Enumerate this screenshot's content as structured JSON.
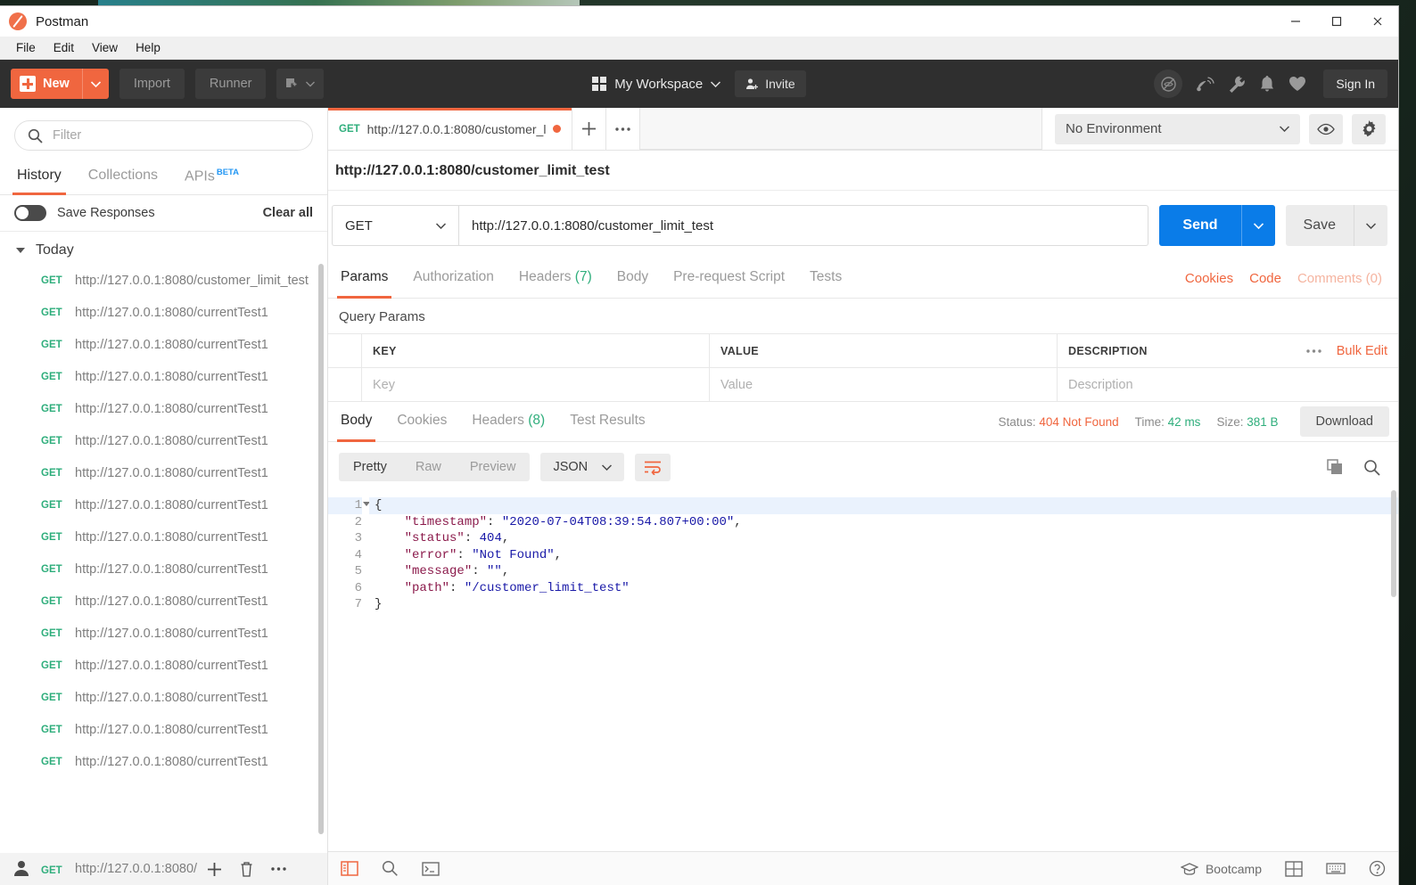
{
  "window": {
    "title": "Postman",
    "controls": {
      "minimize": "minimize-icon",
      "maximize": "maximize-icon",
      "close": "close-icon"
    }
  },
  "menubar": {
    "items": [
      "File",
      "Edit",
      "View",
      "Help"
    ]
  },
  "header": {
    "new_button": "New",
    "import_button": "Import",
    "runner_button": "Runner",
    "workspace": "My Workspace",
    "invite": "Invite",
    "sign_in": "Sign In",
    "icons": [
      "eye-off-icon",
      "satellite-dish-icon",
      "wrench-icon",
      "bell-icon",
      "heart-icon"
    ]
  },
  "sidebar": {
    "filter_placeholder": "Filter",
    "tabs": [
      {
        "label": "History",
        "active": true
      },
      {
        "label": "Collections",
        "active": false
      },
      {
        "label": "APIs",
        "badge": "BETA",
        "active": false
      }
    ],
    "save_responses_label": "Save Responses",
    "save_responses_on": false,
    "clear_all": "Clear all",
    "group_label": "Today",
    "items": [
      {
        "method": "GET",
        "url": "http://127.0.0.1:8080/customer_limit_test"
      },
      {
        "method": "GET",
        "url": "http://127.0.0.1:8080/currentTest1"
      },
      {
        "method": "GET",
        "url": "http://127.0.0.1:8080/currentTest1"
      },
      {
        "method": "GET",
        "url": "http://127.0.0.1:8080/currentTest1"
      },
      {
        "method": "GET",
        "url": "http://127.0.0.1:8080/currentTest1"
      },
      {
        "method": "GET",
        "url": "http://127.0.0.1:8080/currentTest1"
      },
      {
        "method": "GET",
        "url": "http://127.0.0.1:8080/currentTest1"
      },
      {
        "method": "GET",
        "url": "http://127.0.0.1:8080/currentTest1"
      },
      {
        "method": "GET",
        "url": "http://127.0.0.1:8080/currentTest1"
      },
      {
        "method": "GET",
        "url": "http://127.0.0.1:8080/currentTest1"
      },
      {
        "method": "GET",
        "url": "http://127.0.0.1:8080/currentTest1"
      },
      {
        "method": "GET",
        "url": "http://127.0.0.1:8080/currentTest1"
      },
      {
        "method": "GET",
        "url": "http://127.0.0.1:8080/currentTest1"
      },
      {
        "method": "GET",
        "url": "http://127.0.0.1:8080/currentTest1"
      },
      {
        "method": "GET",
        "url": "http://127.0.0.1:8080/currentTest1"
      },
      {
        "method": "GET",
        "url": "http://127.0.0.1:8080/currentTest1"
      }
    ],
    "last_item": {
      "method": "GET",
      "url": "http://127.0.0.1:8080/"
    }
  },
  "request_tab": {
    "method": "GET",
    "label": "http://127.0.0.1:8080/customer_l",
    "unsaved": true
  },
  "environment": {
    "selected": "No Environment"
  },
  "request": {
    "title": "http://127.0.0.1:8080/customer_limit_test",
    "method": "GET",
    "url": "http://127.0.0.1:8080/customer_limit_test",
    "send_label": "Send",
    "save_label": "Save",
    "tabs": [
      {
        "label": "Params",
        "active": true
      },
      {
        "label": "Authorization",
        "active": false
      },
      {
        "label": "Headers",
        "count": "(7)",
        "active": false
      },
      {
        "label": "Body",
        "active": false
      },
      {
        "label": "Pre-request Script",
        "active": false
      },
      {
        "label": "Tests",
        "active": false
      }
    ],
    "links": {
      "cookies": "Cookies",
      "code": "Code",
      "comments": "Comments (0)"
    },
    "query_params_title": "Query Params",
    "table": {
      "headers": [
        "KEY",
        "VALUE",
        "DESCRIPTION"
      ],
      "bulk_edit": "Bulk Edit",
      "placeholder_row": [
        "Key",
        "Value",
        "Description"
      ]
    }
  },
  "response": {
    "tabs": [
      {
        "label": "Body",
        "active": true
      },
      {
        "label": "Cookies",
        "active": false
      },
      {
        "label": "Headers",
        "count": "(8)",
        "active": false
      },
      {
        "label": "Test Results",
        "active": false
      }
    ],
    "status_label": "Status:",
    "status_value": "404 Not Found",
    "time_label": "Time:",
    "time_value": "42 ms",
    "size_label": "Size:",
    "size_value": "381 B",
    "download": "Download",
    "view_modes": [
      {
        "label": "Pretty",
        "active": true
      },
      {
        "label": "Raw",
        "active": false
      },
      {
        "label": "Preview",
        "active": false
      }
    ],
    "format": "JSON",
    "wrap_icon": "wrap-lines-icon",
    "copy_icon": "copy-icon",
    "search_icon": "search-icon",
    "body_lines": [
      {
        "n": "1",
        "tokens": [
          {
            "t": "p",
            "v": "{"
          }
        ]
      },
      {
        "n": "2",
        "tokens": [
          {
            "t": "k",
            "v": "    \"timestamp\""
          },
          {
            "t": "p",
            "v": ": "
          },
          {
            "t": "s",
            "v": "\"2020-07-04T08:39:54.807+00:00\""
          },
          {
            "t": "p",
            "v": ","
          }
        ]
      },
      {
        "n": "3",
        "tokens": [
          {
            "t": "k",
            "v": "    \"status\""
          },
          {
            "t": "p",
            "v": ": "
          },
          {
            "t": "n",
            "v": "404"
          },
          {
            "t": "p",
            "v": ","
          }
        ]
      },
      {
        "n": "4",
        "tokens": [
          {
            "t": "k",
            "v": "    \"error\""
          },
          {
            "t": "p",
            "v": ": "
          },
          {
            "t": "s",
            "v": "\"Not Found\""
          },
          {
            "t": "p",
            "v": ","
          }
        ]
      },
      {
        "n": "5",
        "tokens": [
          {
            "t": "k",
            "v": "    \"message\""
          },
          {
            "t": "p",
            "v": ": "
          },
          {
            "t": "s",
            "v": "\"\""
          },
          {
            "t": "p",
            "v": ","
          }
        ]
      },
      {
        "n": "6",
        "tokens": [
          {
            "t": "k",
            "v": "    \"path\""
          },
          {
            "t": "p",
            "v": ": "
          },
          {
            "t": "s",
            "v": "\"/customer_limit_test\""
          }
        ]
      },
      {
        "n": "7",
        "tokens": [
          {
            "t": "p",
            "v": "}"
          }
        ]
      }
    ]
  },
  "statusbar": {
    "bootcamp": "Bootcamp",
    "left_icons": [
      "sidebar-toggle-icon",
      "search-icon",
      "console-icon"
    ],
    "right_icons": [
      "layout-icon",
      "keyboard-icon",
      "help-icon"
    ]
  }
}
